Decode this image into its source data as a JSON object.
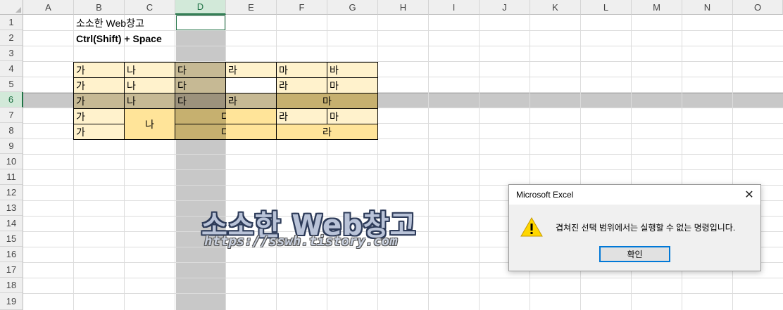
{
  "columns": [
    "A",
    "B",
    "C",
    "D",
    "E",
    "F",
    "G",
    "H",
    "I",
    "J",
    "K",
    "L",
    "M",
    "N",
    "O"
  ],
  "rows": [
    "1",
    "2",
    "3",
    "4",
    "5",
    "6",
    "7",
    "8",
    "9",
    "10",
    "11",
    "12",
    "13",
    "14",
    "15",
    "16",
    "17",
    "18",
    "19"
  ],
  "selected_column": "D",
  "selected_row": "6",
  "cells": {
    "b1": "소소한 Web창고",
    "b2": "Ctrl(Shift) + Space",
    "r4": [
      "가",
      "나",
      "다",
      "라",
      "마",
      "바"
    ],
    "r5": [
      "가",
      "나",
      "다",
      "라",
      "마"
    ],
    "r6": [
      "가",
      "나",
      "다",
      "라",
      "마"
    ],
    "r7": [
      "가",
      "나",
      "다",
      "라",
      "마"
    ],
    "r8": [
      "가",
      "다",
      "라"
    ]
  },
  "dialog": {
    "title": "Microsoft Excel",
    "message": "겹쳐진 선택 범위에서는 실행할 수 없는 명령입니다.",
    "ok_label": "확인",
    "close_icon": "close-icon",
    "warning_icon": "warning-icon"
  },
  "watermark": {
    "title": "소소한 Web창고",
    "url": "https://sswh.tistory.com"
  },
  "colors": {
    "light_yellow": "#fff2cc",
    "tan": "#c6b994",
    "gold": "#d6c27c",
    "gray_selection": "#c8c8c8",
    "accent_green": "#217346"
  }
}
